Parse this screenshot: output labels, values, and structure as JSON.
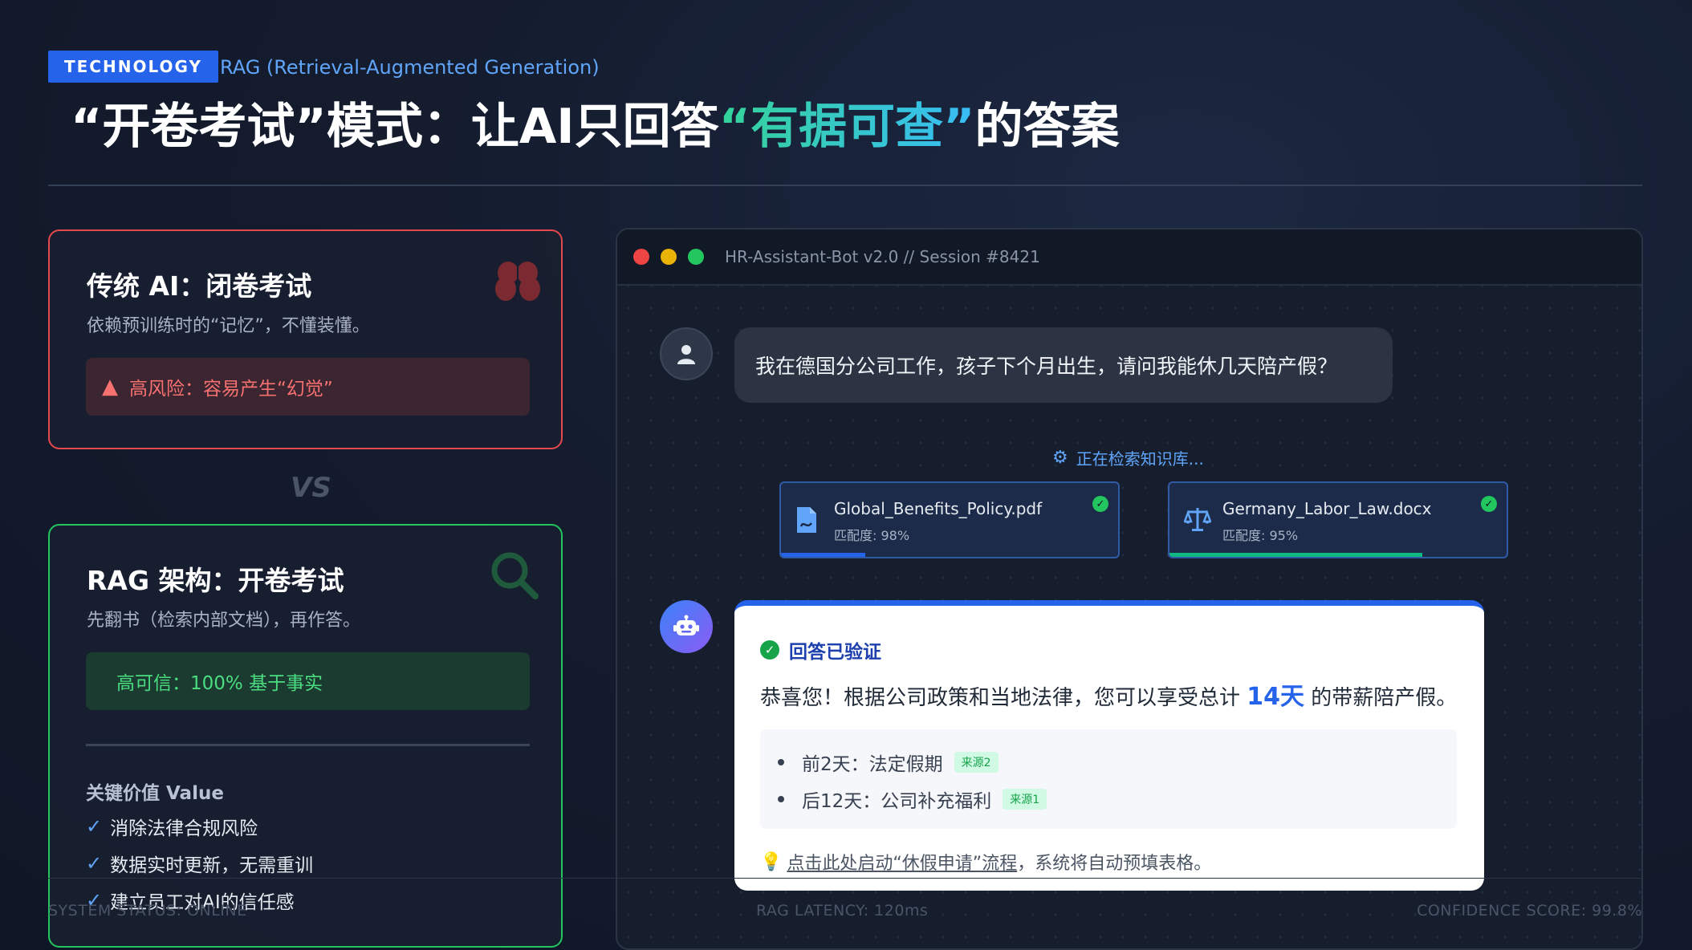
{
  "header": {
    "tag": "TECHNOLOGY",
    "subtag": "RAG (Retrieval-Augmented Generation)",
    "headline_part1": "“开卷考试”模式：让AI只回答",
    "headline_highlight": "“有据可查”",
    "headline_part2": "的答案"
  },
  "traditional": {
    "title": "传统 AI：闭卷考试",
    "desc": "依赖预训练时的“记忆”，不懂装懂。",
    "risk": "高风险：容易产生“幻觉”",
    "icon": "brain-icon"
  },
  "vs": "VS",
  "rag": {
    "title": "RAG 架构：开卷考试",
    "desc": "先翻书（检索内部文档），再作答。",
    "trust": "高可信：100% 基于事实",
    "icon": "search-icon",
    "value_title": "关键价值 Value",
    "values": [
      "消除法律合规风险",
      "数据实时更新，无需重训",
      "建立员工对AI的信任感"
    ]
  },
  "window": {
    "title": "HR-Assistant-Bot v2.0 // Session #8421",
    "user_message": "我在德国分公司工作，孩子下个月出生，请问我能休几天陪产假？",
    "searching": "正在检索知识库...",
    "docs": [
      {
        "name": "Global_Benefits_Policy.pdf",
        "match": "匹配度: 98%",
        "progress": 0.25
      },
      {
        "name": "Germany_Labor_Law.docx",
        "match": "匹配度: 95%",
        "progress": 0.75
      }
    ],
    "answer": {
      "verified": "回答已验证",
      "text_before": "恭喜您！根据公司政策和当地法律，您可以享受总计",
      "days": "14天",
      "text_after": "的带薪陪产假。",
      "points": [
        {
          "text": "前2天：法定假期",
          "source": "来源2"
        },
        {
          "text": "后12天：公司补充福利",
          "source": "来源1"
        }
      ],
      "cta_link": "点击此处启动“休假申请”流程",
      "cta_rest": "，系统将自动预填表格。"
    }
  },
  "footer": {
    "status": "SYSTEM STATUS: ONLINE",
    "latency": "RAG LATENCY: 120ms",
    "confidence": "CONFIDENCE SCORE: 99.8%"
  },
  "colors": {
    "accent": "#2563eb",
    "danger": "#e5484d",
    "success": "#22c55e"
  }
}
